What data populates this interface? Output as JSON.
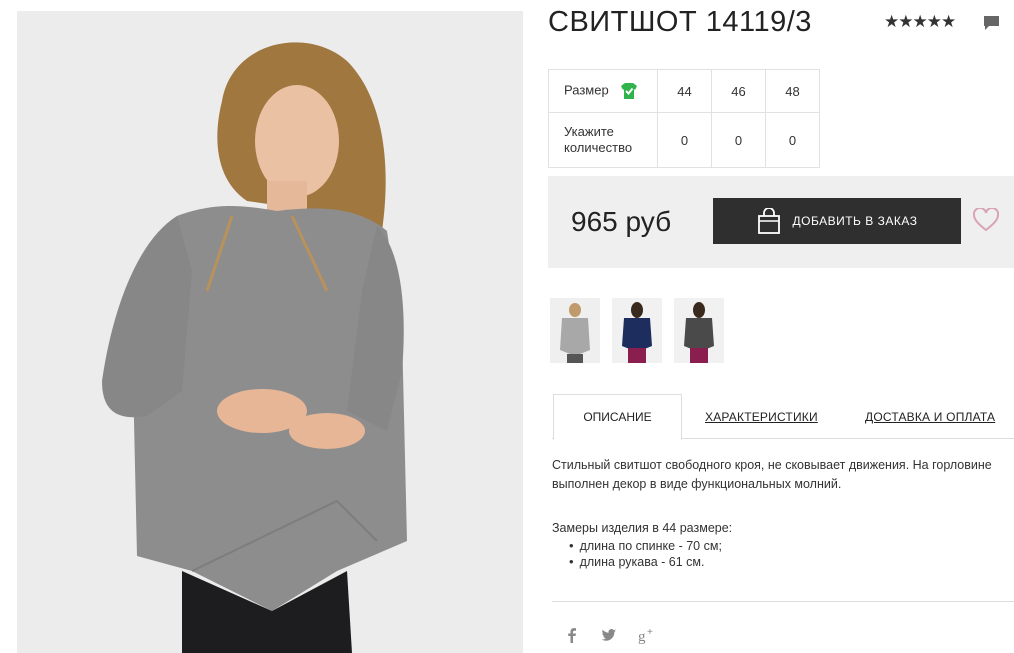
{
  "product": {
    "title": "СВИТШОТ 14119/3",
    "rating_stars": "★★★★★",
    "rating_value": 5,
    "main_image": "model-wearing-grey-sweatshirt"
  },
  "sizes": {
    "size_label": "Размер",
    "qty_label": "Укажите количество",
    "columns": [
      "44",
      "46",
      "48"
    ],
    "quantities": [
      "0",
      "0",
      "0"
    ]
  },
  "purchase": {
    "price": "965 руб",
    "add_button_label": "ДОБАВИТЬ В ЗАКАЗ"
  },
  "thumbnails": [
    {
      "color_name": "grey",
      "color": "#9a9a9a"
    },
    {
      "color_name": "navy",
      "color": "#1d2d5e"
    },
    {
      "color_name": "dark-grey",
      "color": "#4a4a4a"
    }
  ],
  "tabs": {
    "description": "ОПИСАНИЕ",
    "characteristics": "ХАРАКТЕРИСТИКИ",
    "delivery": "ДОСТАВКА И ОПЛАТА"
  },
  "description": {
    "line1": "Стильный свитшот свободного кроя, не сковывает движения. На горловине",
    "line2": "выполнен декор в виде функциональных молний.",
    "measures_title": "Замеры изделия в 44 размере:",
    "measure_items": [
      "длина по спинке - 70 см;",
      "длина рукава - 61 см."
    ]
  },
  "colors": {
    "accent_button": "#2f2f2f",
    "price_panel": "#efefef",
    "favorite": "#d8a3b4",
    "check": "#2fb34a"
  },
  "icons": [
    "comment-icon",
    "check-icon",
    "shopping-bag-icon",
    "heart-icon",
    "facebook-icon",
    "twitter-icon",
    "google-plus-icon"
  ]
}
